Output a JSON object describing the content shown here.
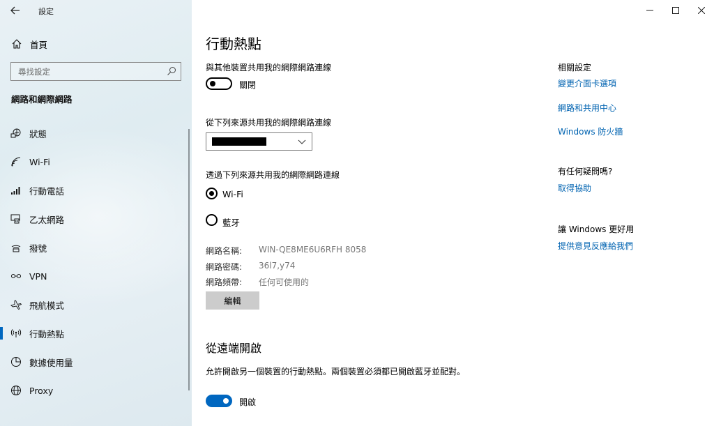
{
  "window": {
    "title": "設定"
  },
  "sidebar": {
    "home_label": "首頁",
    "search_placeholder": "尋找設定",
    "section_title": "網路和網際網路",
    "items": [
      {
        "label": "狀態",
        "icon": "status-icon"
      },
      {
        "label": "Wi-Fi",
        "icon": "wifi-icon"
      },
      {
        "label": "行動電話",
        "icon": "cellular-icon"
      },
      {
        "label": "乙太網路",
        "icon": "ethernet-icon"
      },
      {
        "label": "撥號",
        "icon": "dialup-icon"
      },
      {
        "label": "VPN",
        "icon": "vpn-icon"
      },
      {
        "label": "飛航模式",
        "icon": "airplane-icon"
      },
      {
        "label": "行動熱點",
        "icon": "hotspot-icon",
        "active": true
      },
      {
        "label": "數據使用量",
        "icon": "data-usage-icon"
      },
      {
        "label": "Proxy",
        "icon": "globe-icon"
      }
    ]
  },
  "main": {
    "title": "行動熱點",
    "share_label": "與其他裝置共用我的網際網路連線",
    "share_toggle_label": "關閉",
    "share_toggle_on": false,
    "source_label": "從下列來源共用我的網際網路連線",
    "via_label": "透過下列來源共用我的網際網路連線",
    "via_options": [
      {
        "label": "Wi-Fi",
        "checked": true
      },
      {
        "label": "藍牙",
        "checked": false
      }
    ],
    "network_name_key": "網路名稱:",
    "network_name_value": "WIN-QE8ME6U6RFH 8058",
    "network_password_key": "網路密碼:",
    "network_password_value": "36l7,y74",
    "network_band_key": "網路頻帶:",
    "network_band_value": "任何可使用的",
    "edit_label": "編輯",
    "remote_title": "從遠端開啟",
    "remote_desc": "允許開啟另一個裝置的行動熱點。兩個裝置必須都已開啟藍牙並配對。",
    "remote_toggle_label": "開啟",
    "remote_toggle_on": true
  },
  "related": {
    "title": "相關設定",
    "links": [
      "變更介面卡選項",
      "網路和共用中心",
      "Windows 防火牆"
    ],
    "help_title": "有任何疑問嗎?",
    "help_link": "取得協助",
    "feedback_title": "讓 Windows 更好用",
    "feedback_link": "提供意見反應給我們"
  },
  "colors": {
    "accent": "#0067c0",
    "link": "#0063b1"
  }
}
